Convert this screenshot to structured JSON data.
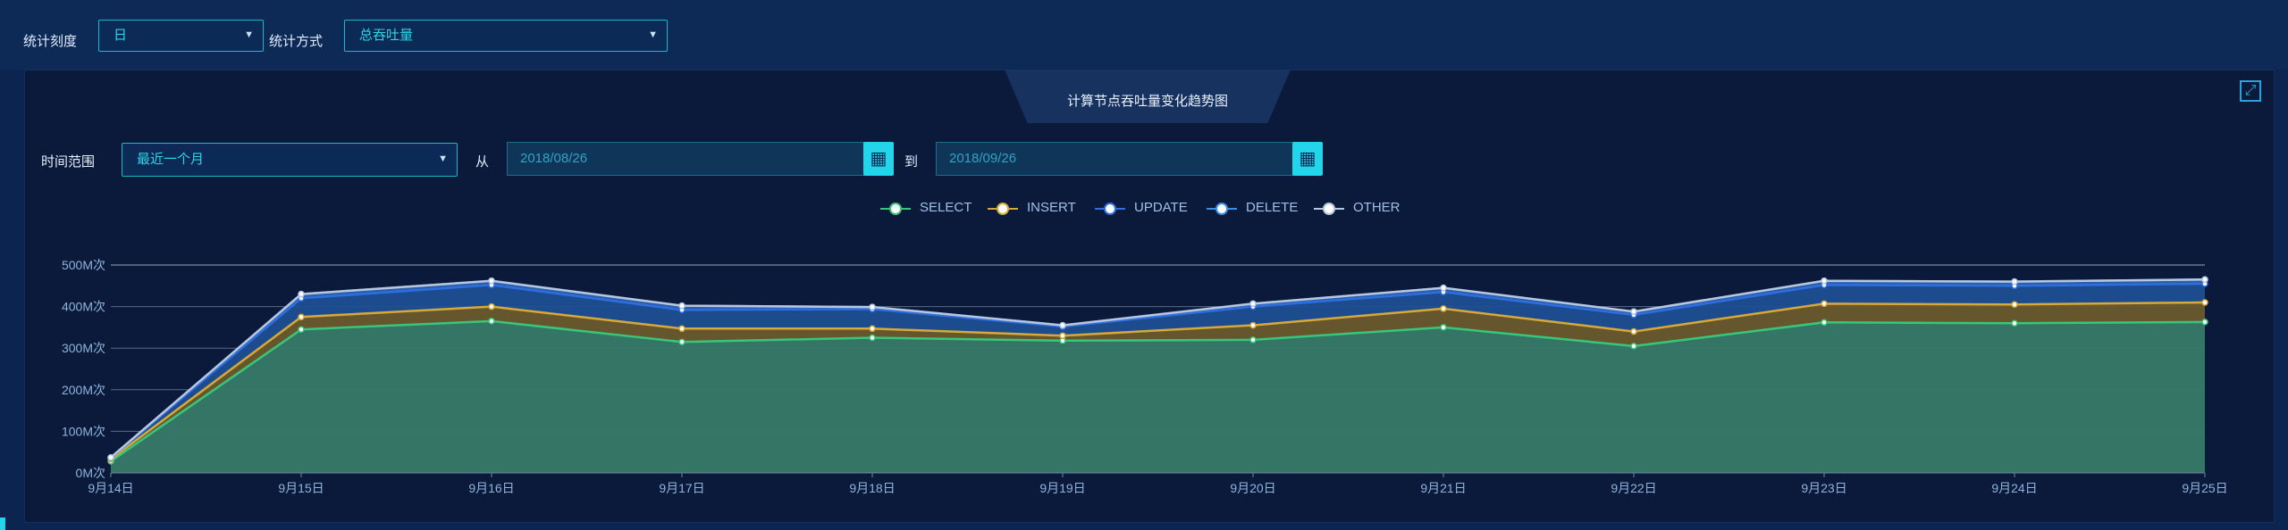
{
  "filters": {
    "granularity_label": "统计刻度",
    "granularity_value": "日",
    "method_label": "统计方式",
    "method_value": "总吞吐量"
  },
  "panel": {
    "title": "计算节点吞吐量变化趋势图",
    "range_label": "时间范围",
    "range_value": "最近一个月",
    "from_label": "从",
    "from_date": "2018/08/26",
    "to_label": "到",
    "to_date": "2018/09/26"
  },
  "icons": {
    "expand": "expand-icon",
    "calendar": "calendar-icon",
    "dropdown": "chevron-down-icon"
  },
  "chart_data": {
    "type": "area",
    "x": [
      "9月14日",
      "9月15日",
      "9月16日",
      "9月17日",
      "9月18日",
      "9月19日",
      "9月20日",
      "9月21日",
      "9月22日",
      "9月23日",
      "9月24日",
      "9月25日"
    ],
    "ylim": [
      0,
      500
    ],
    "yticks": [
      "0M次",
      "100M次",
      "200M次",
      "300M次",
      "400M次",
      "500M次"
    ],
    "stacked": true,
    "grid": true,
    "legend_position": "top-center",
    "series": [
      {
        "name": "SELECT",
        "color": "#38c77a",
        "values": [
          28,
          345,
          365,
          315,
          325,
          318,
          320,
          350,
          305,
          362,
          360,
          363
        ]
      },
      {
        "name": "INSERT",
        "color": "#d7a93a",
        "values": [
          5,
          30,
          35,
          32,
          22,
          12,
          35,
          45,
          35,
          45,
          45,
          47
        ]
      },
      {
        "name": "UPDATE",
        "color": "#2f6ee0",
        "values": [
          3,
          45,
          52,
          45,
          47,
          22,
          45,
          40,
          40,
          45,
          45,
          45
        ]
      },
      {
        "name": "DELETE",
        "color": "#3a8fe8",
        "values": [
          1,
          10,
          10,
          10,
          5,
          3,
          7,
          10,
          8,
          10,
          10,
          10
        ]
      },
      {
        "name": "OTHER",
        "color": "#b8c7de",
        "values": [
          0,
          0,
          0,
          0,
          0,
          0,
          0,
          0,
          0,
          0,
          0,
          0
        ]
      }
    ]
  }
}
